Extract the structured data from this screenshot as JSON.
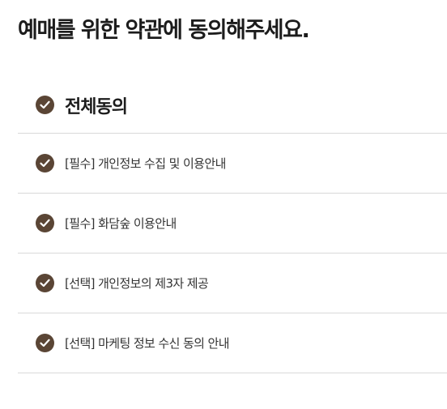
{
  "page": {
    "title": "예매를 위한 약관에 동의해주세요."
  },
  "theme": {
    "accent": "#5a4535",
    "check_mark": "#ffffff",
    "divider": "#d9d9d9"
  },
  "agreements": {
    "all": {
      "label": "전체동의",
      "checked": true,
      "icon": "check-circle-icon"
    },
    "items": [
      {
        "label": "[필수] 개인정보 수집 및 이용안내",
        "checked": true,
        "icon": "check-circle-icon"
      },
      {
        "label": "[필수] 화담숲 이용안내",
        "checked": true,
        "icon": "check-circle-icon"
      },
      {
        "label": "[선택] 개인정보의 제3자 제공",
        "checked": true,
        "icon": "check-circle-icon"
      },
      {
        "label": "[선택] 마케팅 정보 수신 동의 안내",
        "checked": true,
        "icon": "check-circle-icon"
      }
    ]
  }
}
